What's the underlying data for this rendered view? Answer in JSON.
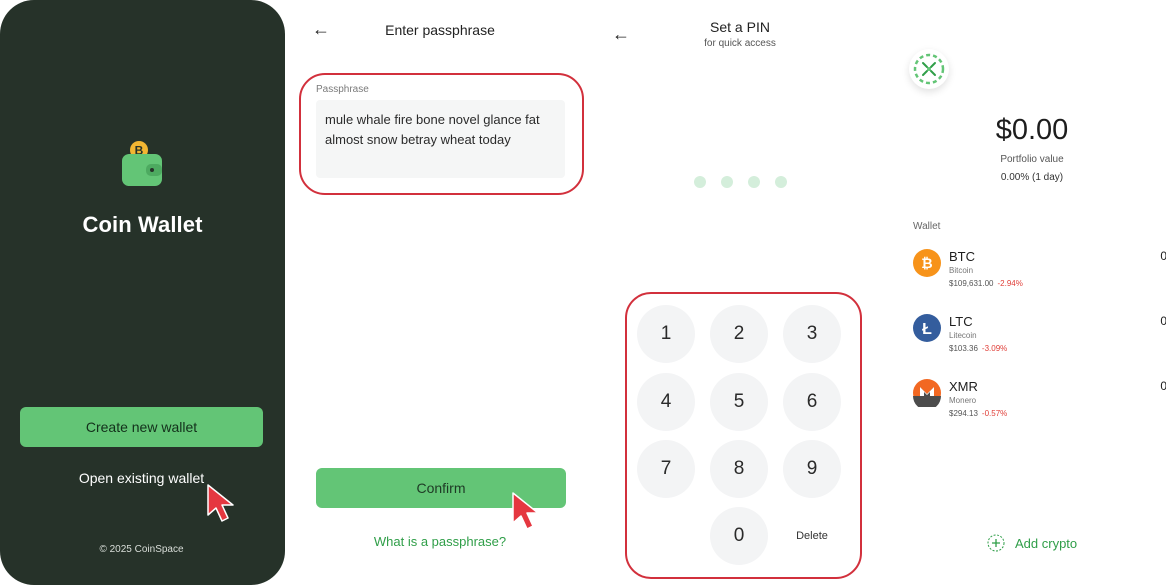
{
  "welcome": {
    "app_title": "Coin Wallet",
    "create_button": "Create new wallet",
    "open_link": "Open existing wallet",
    "copyright": "© 2025 CoinSpace"
  },
  "passphrase": {
    "title": "Enter passphrase",
    "field_label": "Passphrase",
    "field_value": "mule whale fire bone novel glance fat almost snow betray wheat today",
    "confirm_button": "Confirm",
    "help_link": "What is a passphrase?"
  },
  "pin": {
    "title": "Set a PIN",
    "subtitle": "for quick access",
    "keys": [
      "1",
      "2",
      "3",
      "4",
      "5",
      "6",
      "7",
      "8",
      "9",
      "0"
    ],
    "delete_label": "Delete",
    "entered_digits": 0,
    "total_digits": 4
  },
  "wallet": {
    "balance": "$0.00",
    "balance_label": "Portfolio value",
    "balance_change": "0.00% (1 day)",
    "section_label": "Wallet",
    "coins": [
      {
        "symbol": "BTC",
        "name": "Bitcoin",
        "price": "$109,631.00",
        "change": "-2.94%",
        "balance": "0",
        "color": "#f7931a",
        "icon": "bitcoin-icon"
      },
      {
        "symbol": "LTC",
        "name": "Litecoin",
        "price": "$103.36",
        "change": "-3.09%",
        "balance": "0",
        "color": "#345d9d",
        "icon": "litecoin-icon"
      },
      {
        "symbol": "XMR",
        "name": "Monero",
        "price": "$294.13",
        "change": "-0.57%",
        "balance": "0",
        "color": "#f26822",
        "icon": "monero-icon"
      }
    ],
    "add_label": "Add crypto"
  },
  "colors": {
    "accent_green": "#63c576",
    "link_green": "#2f9e48",
    "dark_bg": "#263229",
    "highlight_red": "#d2303c",
    "negative_red": "#e0403a"
  }
}
